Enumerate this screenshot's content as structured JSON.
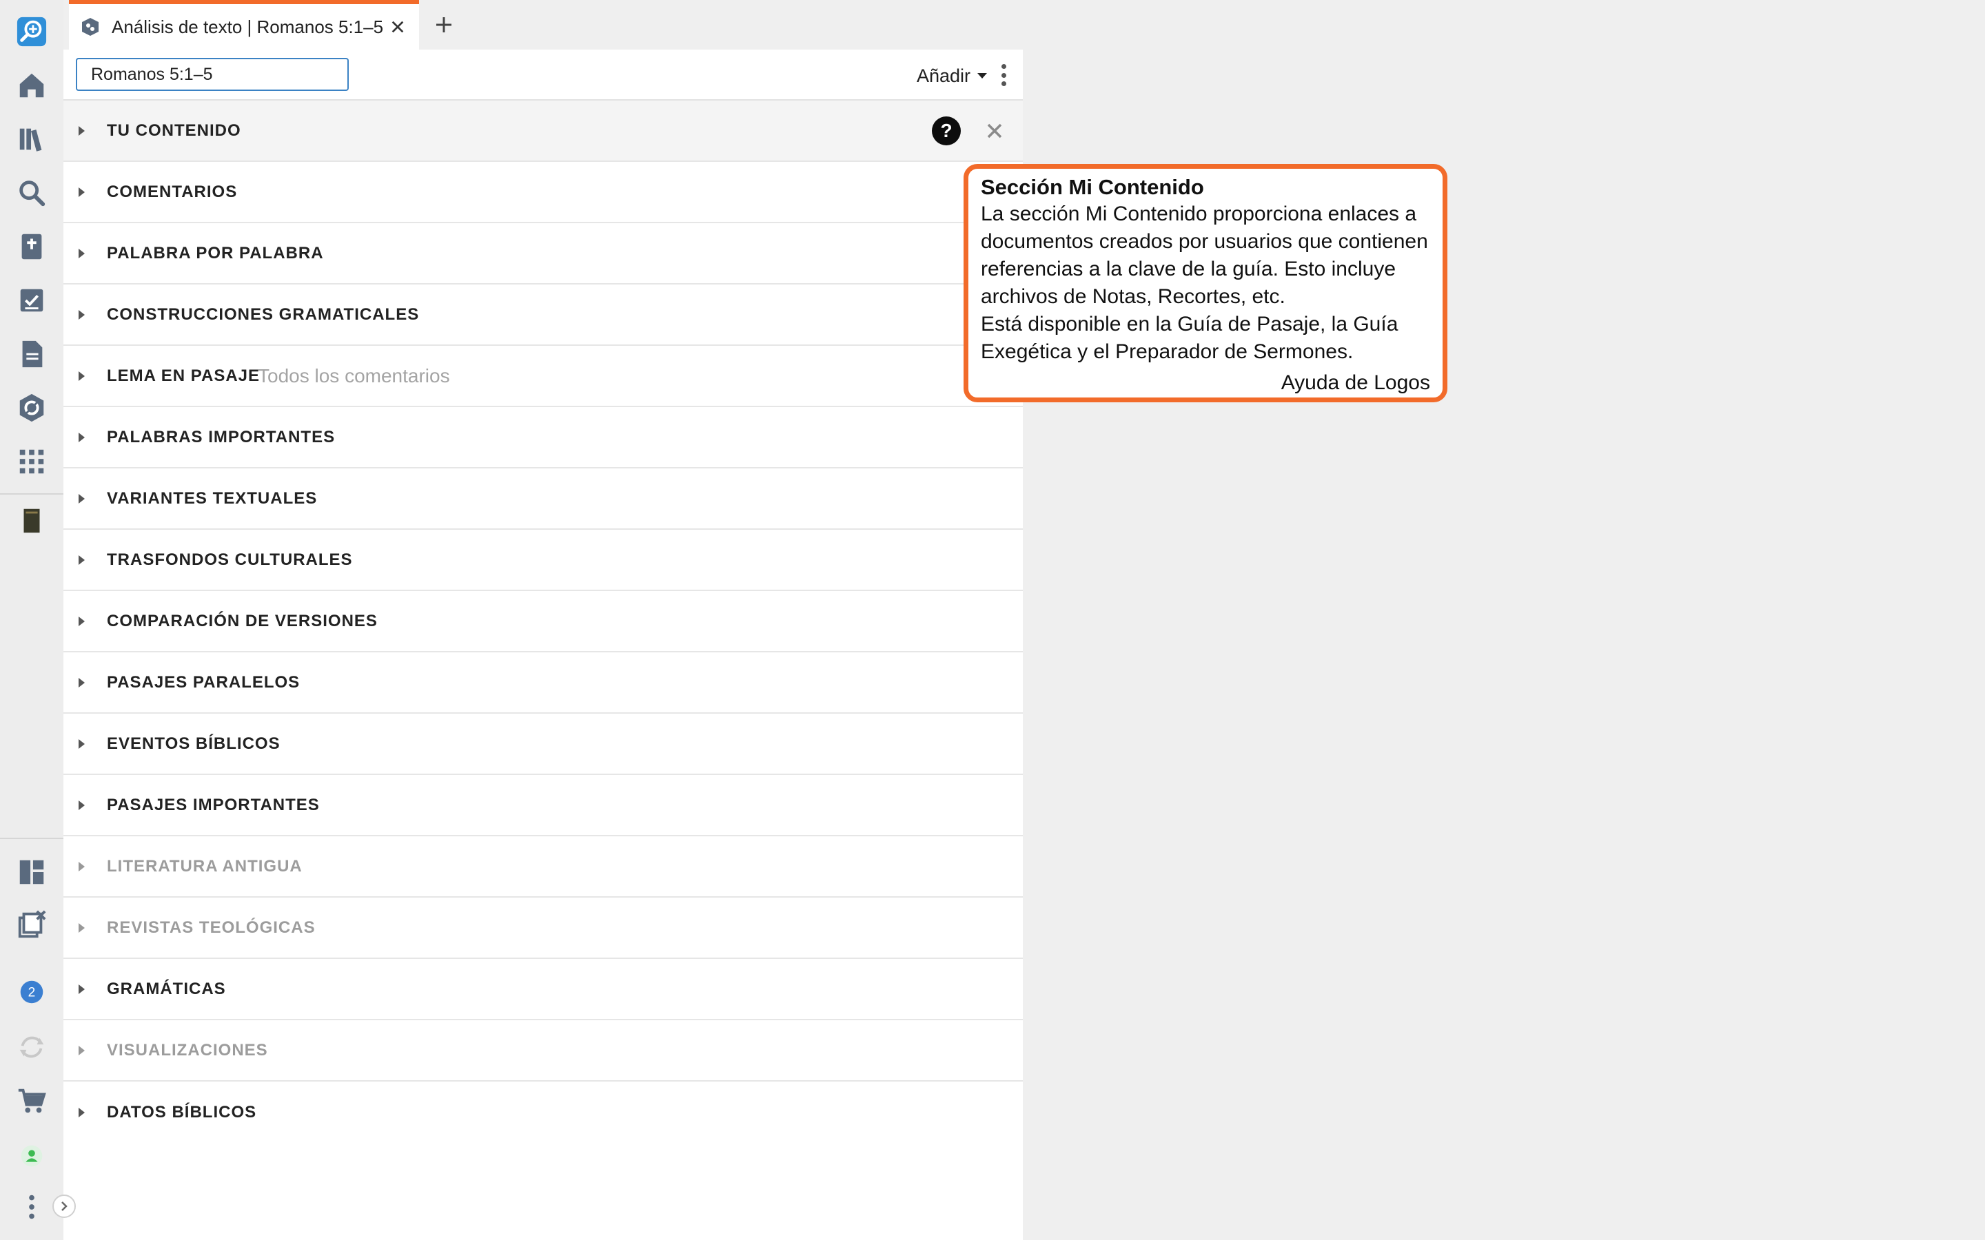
{
  "tab": {
    "title": "Análisis de texto | Romanos 5:1–5",
    "close_icon": "close-icon",
    "new_tab_icon": "plus-icon"
  },
  "toolbar": {
    "reference_value": "Romanos 5:1–5",
    "add_label": "Añadir",
    "more_icon": "more-vertical-icon"
  },
  "sidebar": {
    "notification_count": "2",
    "icons": [
      "logos-search-icon",
      "home-icon",
      "library-icon",
      "search-icon",
      "bible-icon",
      "checklist-icon",
      "document-icon",
      "guide-icon",
      "apps-icon",
      "book-icon",
      "layouts-icon",
      "close-panels-icon",
      "notifications-icon",
      "sync-icon",
      "cart-icon",
      "user-icon",
      "more-icon"
    ]
  },
  "sections": [
    {
      "label": "TU CONTENIDO",
      "enabled": true
    },
    {
      "label": "COMENTARIOS",
      "enabled": true
    },
    {
      "label": "PALABRA POR PALABRA",
      "enabled": true
    },
    {
      "label": "CONSTRUCCIONES GRAMATICALES",
      "enabled": true
    },
    {
      "label": "LEMA EN PASAJE",
      "sub": "Todos los comentarios",
      "enabled": true
    },
    {
      "label": "PALABRAS IMPORTANTES",
      "enabled": true
    },
    {
      "label": "VARIANTES TEXTUALES",
      "enabled": true
    },
    {
      "label": "TRASFONDOS CULTURALES",
      "enabled": true
    },
    {
      "label": "COMPARACIÓN DE VERSIONES",
      "enabled": true
    },
    {
      "label": "PASAJES PARALELOS",
      "enabled": true
    },
    {
      "label": "EVENTOS BÍBLICOS",
      "enabled": true
    },
    {
      "label": "PASAJES IMPORTANTES",
      "enabled": true
    },
    {
      "label": "LITERATURA ANTIGUA",
      "enabled": false
    },
    {
      "label": "REVISTAS TEOLÓGICAS",
      "enabled": false
    },
    {
      "label": "GRAMÁTICAS",
      "enabled": true
    },
    {
      "label": "VISUALIZACIONES",
      "enabled": false
    },
    {
      "label": "DATOS BÍBLICOS",
      "enabled": true
    }
  ],
  "first_row": {
    "help_label": "?"
  },
  "callout": {
    "title": "Sección Mi Contenido",
    "body_line1": "La sección Mi Contenido proporciona enlaces a documentos creados por usuarios que contienen referencias a la clave de la guía. Esto incluye archivos de Notas, Recortes, etc.",
    "body_line2": "Está disponible en la Guía de Pasaje, la Guía Exegética y el Preparador de Sermones.",
    "source": "Ayuda de Logos"
  },
  "colors": {
    "accent": "#f26b2a",
    "focus_border": "#3b82c4",
    "sidebar_icon": "#5a6a7e",
    "notification_badge": "#3b7fd1",
    "user_green": "#3dbb52"
  }
}
